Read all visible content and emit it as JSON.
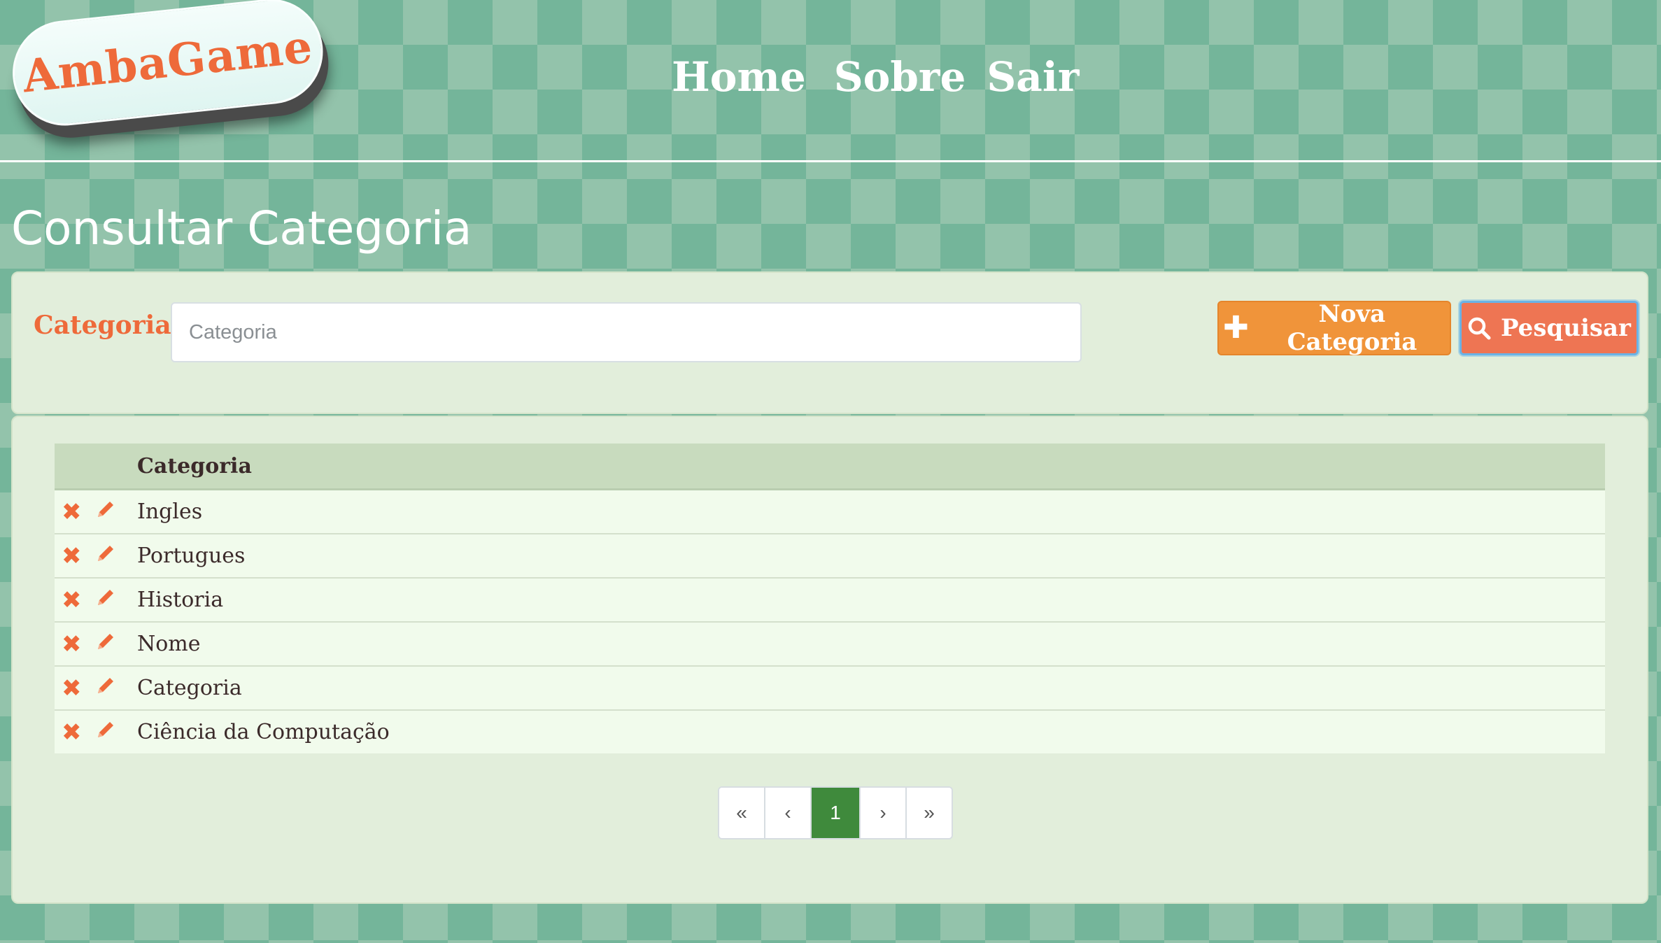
{
  "brand": {
    "name": "AmbaGame"
  },
  "nav": {
    "home": "Home",
    "about": "Sobre",
    "logout": "Sair"
  },
  "page": {
    "title": "Consultar Categoria"
  },
  "search": {
    "label": "Categoria:",
    "placeholder": "Categoria",
    "value": "",
    "new_button": "Nova Categoria",
    "search_button": "Pesquisar"
  },
  "table": {
    "header": "Categoria",
    "rows": [
      {
        "name": "Ingles"
      },
      {
        "name": "Portugues"
      },
      {
        "name": "Historia"
      },
      {
        "name": "Nome"
      },
      {
        "name": "Categoria"
      },
      {
        "name": "Ciência da Computação"
      }
    ],
    "icons": {
      "delete": "delete-icon",
      "edit": "pencil-icon"
    }
  },
  "pagination": {
    "first": "«",
    "prev": "‹",
    "current": "1",
    "next": "›",
    "last": "»"
  },
  "colors": {
    "accent": "#ee6a3a",
    "new_button": "#f0943a",
    "search_button": "#ee7553",
    "active_page": "#3f8a3c"
  }
}
